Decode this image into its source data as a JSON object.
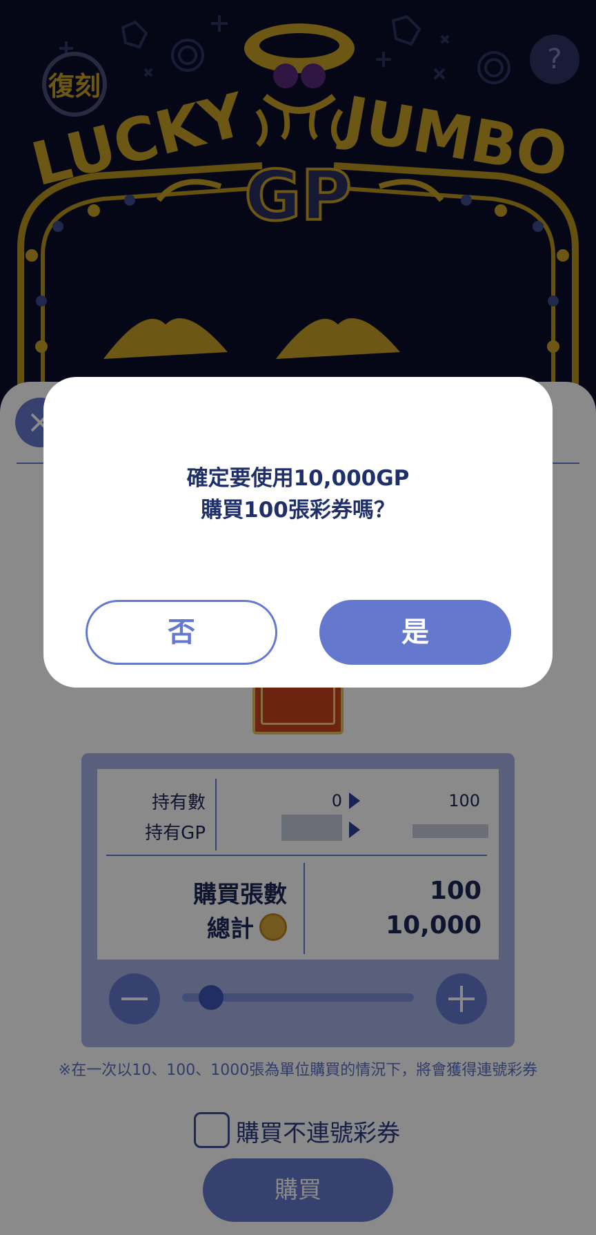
{
  "header": {
    "logo_badge": "復刻",
    "logo_title": "LUCKY JUMBO",
    "logo_sub": "GP",
    "help_label": "?"
  },
  "purchase": {
    "held_count_label": "持有數",
    "held_gp_label": "持有GP",
    "held_count_from": "0",
    "held_count_to": "100",
    "buy_count_label": "購買張數",
    "total_label": "總計",
    "buy_count_value": "100",
    "total_value": "10,000",
    "note": "※在一次以10、100、1000張為單位購買的情況下，將會獲得連號彩券",
    "checkbox_label": "購買不連號彩券",
    "buy_button": "購買"
  },
  "dialog": {
    "line1": "確定要使用10,000GP",
    "line2": "購買100張彩券嗎？",
    "no_label": "否",
    "yes_label": "是"
  },
  "colors": {
    "accent": "#6478cd",
    "navy_bg": "#0b0e2a",
    "gold": "#c9a227"
  }
}
